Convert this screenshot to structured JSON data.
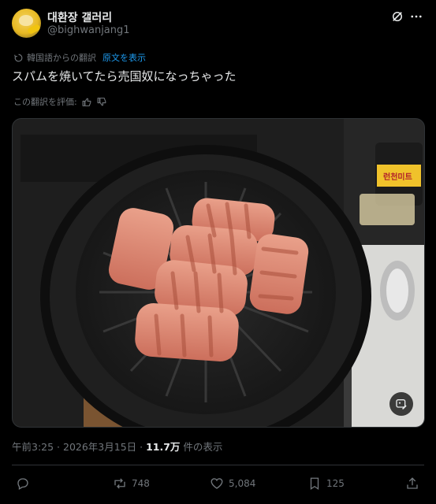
{
  "author": {
    "name": "대환장 갤러리",
    "handle": "@bighwanjang1"
  },
  "translation": {
    "note": "韓国語からの翻訳",
    "link": "原文を表示"
  },
  "post": {
    "text": "スパムを焼いてたら売国奴になっちゃった"
  },
  "rating": {
    "label": "この翻訳を評価:"
  },
  "meta": {
    "time": "午前3:25",
    "sep1": " · ",
    "date": "2026年3月15日",
    "sep2": " · ",
    "views": "11.7万",
    "views_label": " 件の表示"
  },
  "actions": {
    "replies": "",
    "reposts": "748",
    "likes": "5,084",
    "bookmarks": "125"
  },
  "media": {
    "can_label": "런천미트"
  },
  "colors": {
    "accent": "#1d9bf0",
    "muted": "#71767b",
    "text": "#e7e9ea",
    "background": "#000000"
  }
}
